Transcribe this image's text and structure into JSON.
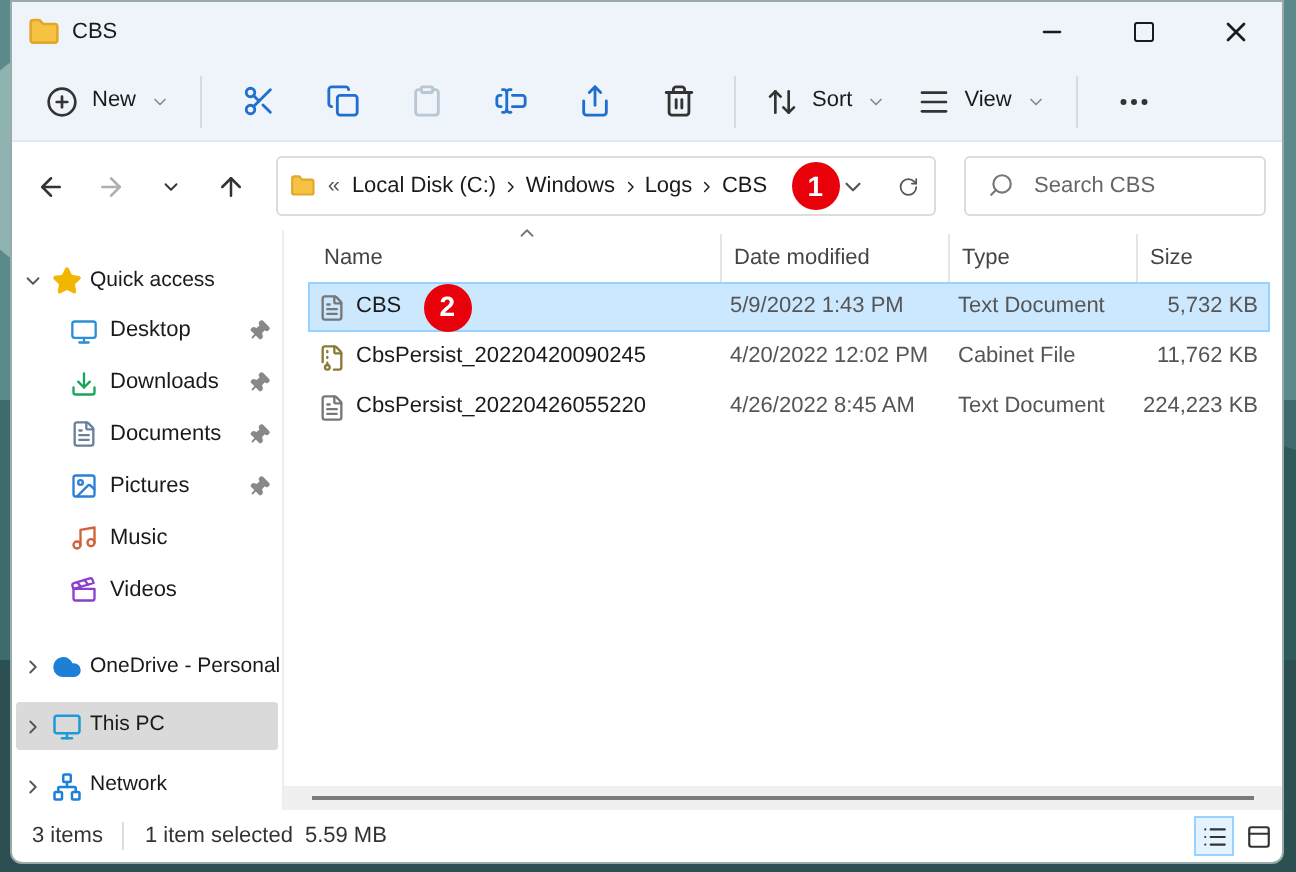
{
  "window": {
    "title": "CBS"
  },
  "toolbar": [
    {
      "kind": "labeled",
      "label": "New",
      "disabled": false
    },
    {
      "kind": "icon",
      "disabled": false
    },
    {
      "kind": "icon",
      "disabled": false
    },
    {
      "kind": "icon",
      "disabled": true
    },
    {
      "kind": "icon",
      "disabled": false
    },
    {
      "kind": "icon",
      "disabled": false
    },
    {
      "kind": "icon",
      "disabled": false
    },
    {
      "kind": "labeled",
      "label": "Sort",
      "disabled": false
    },
    {
      "kind": "labeled",
      "label": "View",
      "disabled": false
    },
    {
      "kind": "more",
      "disabled": false
    }
  ],
  "nav_buttons": [
    {
      "disabled": false
    },
    {
      "disabled": true
    },
    {
      "disabled": false
    },
    {
      "disabled": false
    }
  ],
  "address": {
    "overflow": "«",
    "segments": [
      "Local Disk (C:)",
      "Windows",
      "Logs",
      "CBS"
    ],
    "callout": "1"
  },
  "search": {
    "placeholder": "Search CBS"
  },
  "sidebar": {
    "items": [
      {
        "label": "Quick access",
        "expanded": true,
        "selected": false,
        "children": [
          {
            "label": "Desktop",
            "pinned": true
          },
          {
            "label": "Downloads",
            "pinned": true
          },
          {
            "label": "Documents",
            "pinned": true
          },
          {
            "label": "Pictures",
            "pinned": true
          },
          {
            "label": "Music",
            "pinned": false
          },
          {
            "label": "Videos",
            "pinned": false
          }
        ]
      },
      {
        "label": "OneDrive - Personal",
        "expanded": false,
        "selected": false
      },
      {
        "label": "This PC",
        "expanded": false,
        "selected": true
      },
      {
        "label": "Network",
        "expanded": false,
        "selected": false
      }
    ]
  },
  "table": {
    "columns": [
      {
        "label": "Name",
        "sorted": true
      },
      {
        "label": "Date modified",
        "sorted": false
      },
      {
        "label": "Type",
        "sorted": false
      },
      {
        "label": "Size",
        "sorted": false
      }
    ],
    "rows": [
      {
        "kind": "text",
        "name": "CBS",
        "date": "5/9/2022 1:43 PM",
        "type": "Text Document",
        "size": "5,732 KB",
        "selected": true,
        "callout": "2"
      },
      {
        "kind": "cabinet",
        "name": "CbsPersist_20220420090245",
        "date": "4/20/2022 12:02 PM",
        "type": "Cabinet File",
        "size": "11,762 KB",
        "selected": false
      },
      {
        "kind": "text",
        "name": "CbsPersist_20220426055220",
        "date": "4/26/2022 8:45 AM",
        "type": "Text Document",
        "size": "224,223 KB",
        "selected": false
      }
    ]
  },
  "status_bar": {
    "items": "3 items",
    "selection": "1 item selected",
    "size": "5.59 MB"
  },
  "views": [
    {
      "selected": true
    },
    {
      "selected": false
    }
  ]
}
